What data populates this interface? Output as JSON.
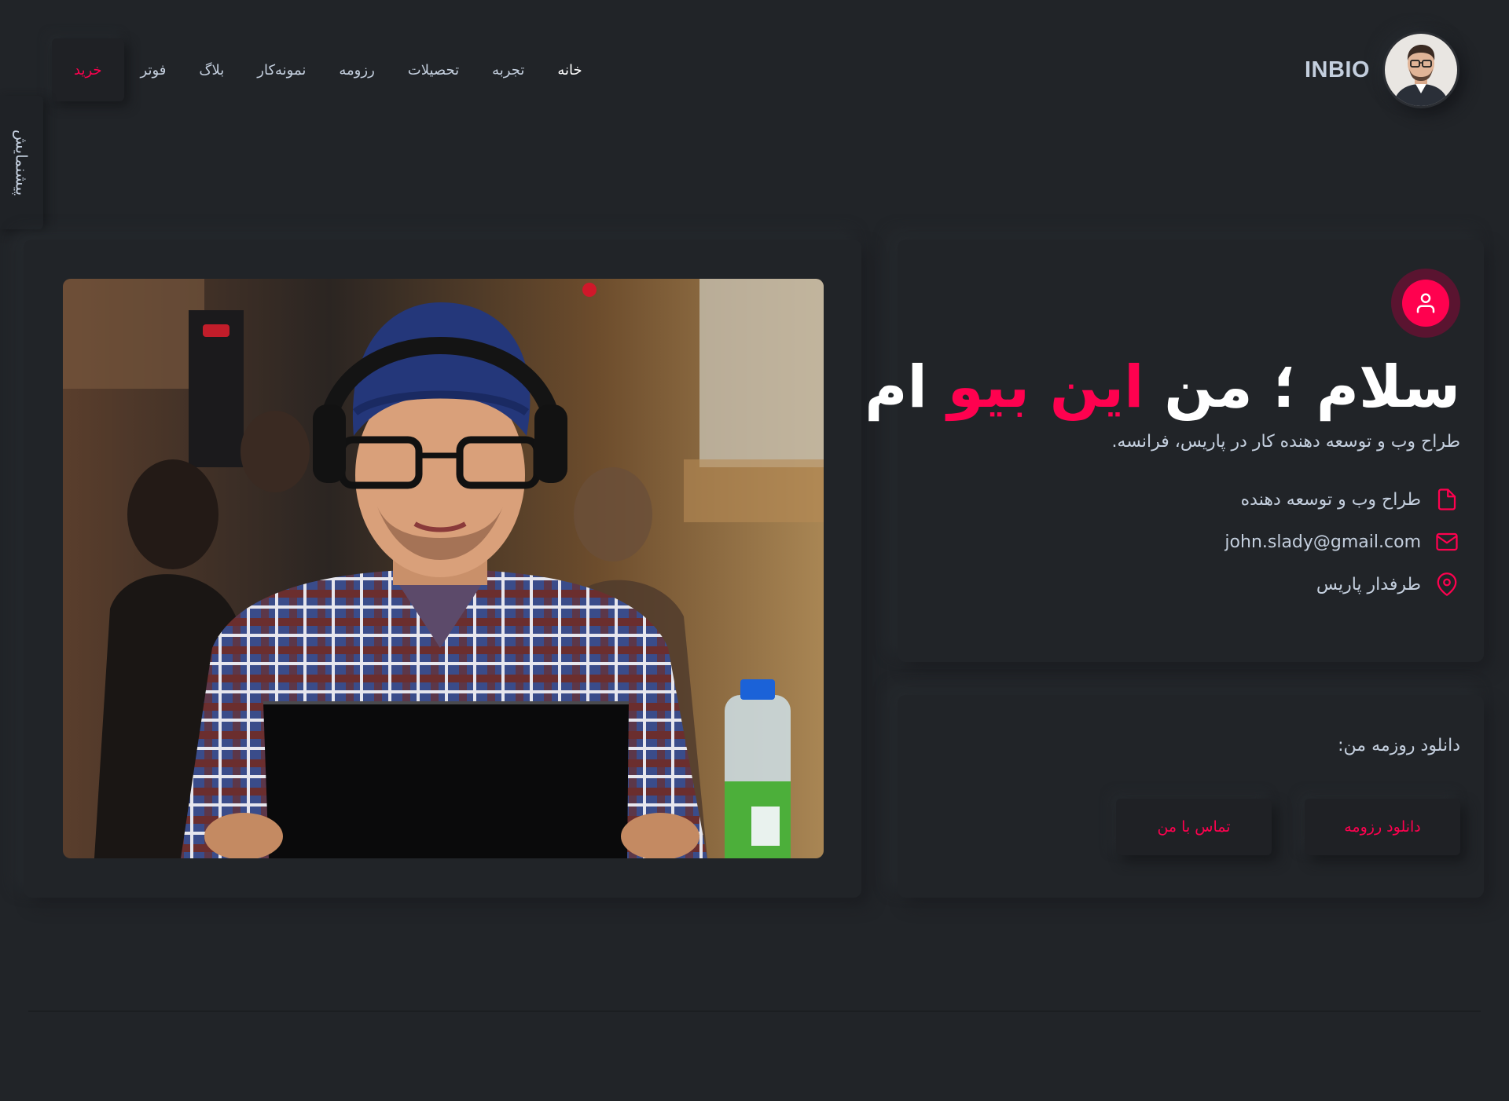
{
  "brand": {
    "name": "INBIO",
    "avatar_icon": "portrait-avatar"
  },
  "nav": {
    "items": [
      {
        "label": "خانه",
        "active": true
      },
      {
        "label": "تجربه"
      },
      {
        "label": "تحصیلات"
      },
      {
        "label": "رزومه"
      },
      {
        "label": "نمونه‌کار"
      },
      {
        "label": "بلاگ"
      },
      {
        "label": "فوتر"
      }
    ],
    "buy_label": "خرید"
  },
  "side_tab": {
    "label": "پیشنمایش"
  },
  "intro": {
    "badge_icon": "user-icon",
    "title_part1": "سلام ؛ من",
    "title_accent": "این بیو",
    "title_part2": "ام",
    "subtitle": "طراح وب و توسعه دهنده کار در پاریس، فرانسه.",
    "info": [
      {
        "icon": "file-icon",
        "text": "طراح وب و توسعه دهنده"
      },
      {
        "icon": "mail-icon",
        "text": "john.slady@gmail.com"
      },
      {
        "icon": "map-pin-icon",
        "text": "طرفدار پاریس"
      }
    ]
  },
  "download": {
    "label": "دانلود روزمه من:",
    "resume_button": "دانلود رزومه",
    "contact_button": "تماس با من"
  },
  "colors": {
    "background": "#212428",
    "accent": "#ff014f",
    "text": "#c4cfde",
    "heading": "#ffffff"
  }
}
